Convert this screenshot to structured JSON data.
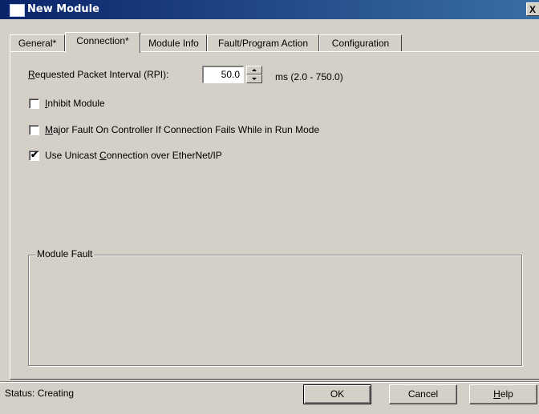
{
  "window": {
    "title": "New Module",
    "close_glyph": "X"
  },
  "tabs": [
    {
      "label": "General*",
      "active": false
    },
    {
      "label": "Connection*",
      "active": true
    },
    {
      "label": "Module Info",
      "active": false
    },
    {
      "label": "Fault/Program Action",
      "active": false
    },
    {
      "label": "Configuration",
      "active": false
    }
  ],
  "connection": {
    "rpi_label_accel": "R",
    "rpi_label_rest": "equested Packet Interval (RPI):",
    "rpi_value": "50.0",
    "rpi_range": "ms (2.0 - 750.0)",
    "inhibit": {
      "accel": "I",
      "rest": "nhibit Module",
      "checked": false
    },
    "major_fault": {
      "accel": "M",
      "rest": "ajor Fault On Controller If Connection Fails While in Run Mode",
      "checked": false
    },
    "unicast": {
      "pre": "Use Unicast ",
      "accel": "C",
      "rest": "onnection over EtherNet/IP",
      "checked": true
    },
    "check_glyph": "✔"
  },
  "module_fault": {
    "legend": "Module Fault"
  },
  "status": {
    "text": "Status:  Creating"
  },
  "buttons": {
    "ok": "OK",
    "cancel": "Cancel",
    "help_accel": "H",
    "help_rest": "elp"
  },
  "colors": {
    "titlebar_start": "#0a246a",
    "titlebar_end": "#3a6ea5",
    "face": "#d4d0c8"
  },
  "icons": {
    "window": "window-icon",
    "close": "close-icon",
    "spin_up": "chevron-up-icon",
    "spin_down": "chevron-down-icon",
    "check": "check-icon"
  }
}
